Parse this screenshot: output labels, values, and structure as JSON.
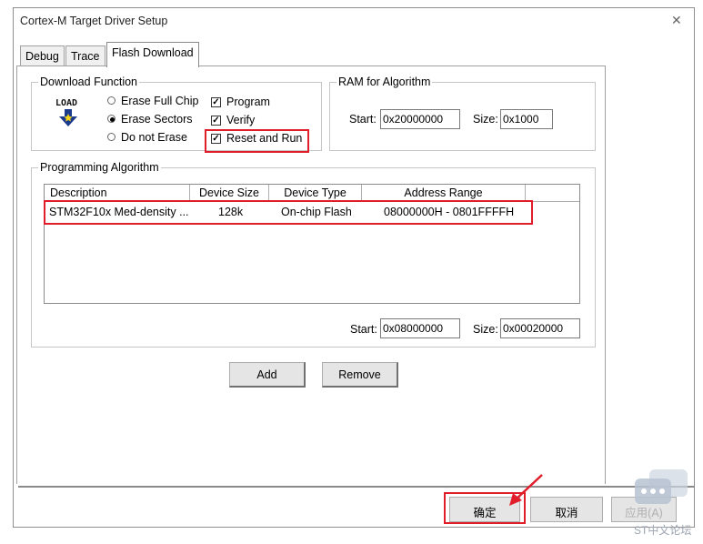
{
  "window": {
    "title": "Cortex-M Target Driver Setup"
  },
  "tabs": [
    {
      "label": "Debug"
    },
    {
      "label": "Trace"
    },
    {
      "label": "Flash Download"
    }
  ],
  "download_function": {
    "title": "Download Function",
    "icon_text": "LOAD",
    "erase_options": [
      {
        "label": "Erase Full Chip",
        "selected": false
      },
      {
        "label": "Erase Sectors",
        "selected": true
      },
      {
        "label": "Do not Erase",
        "selected": false
      }
    ],
    "checks": [
      {
        "label": "Program",
        "checked": true
      },
      {
        "label": "Verify",
        "checked": true
      },
      {
        "label": "Reset and Run",
        "checked": true
      }
    ]
  },
  "ram": {
    "title": "RAM for Algorithm",
    "start_label": "Start:",
    "start_value": "0x20000000",
    "size_label": "Size:",
    "size_value": "0x1000"
  },
  "algorithm": {
    "title": "Programming Algorithm",
    "columns": [
      "Description",
      "Device Size",
      "Device Type",
      "Address Range"
    ],
    "rows": [
      [
        "STM32F10x Med-density ...",
        "128k",
        "On-chip Flash",
        "08000000H - 0801FFFFH"
      ]
    ],
    "start_label": "Start:",
    "start_value": "0x08000000",
    "size_label": "Size:",
    "size_value": "0x00020000"
  },
  "buttons": {
    "add": "Add",
    "remove": "Remove"
  },
  "footer": {
    "ok": "确定",
    "cancel": "取消",
    "apply": "应用(A)"
  },
  "watermark": {
    "text": "ST中文论坛"
  },
  "colors": {
    "highlight": "#e21d2a"
  }
}
